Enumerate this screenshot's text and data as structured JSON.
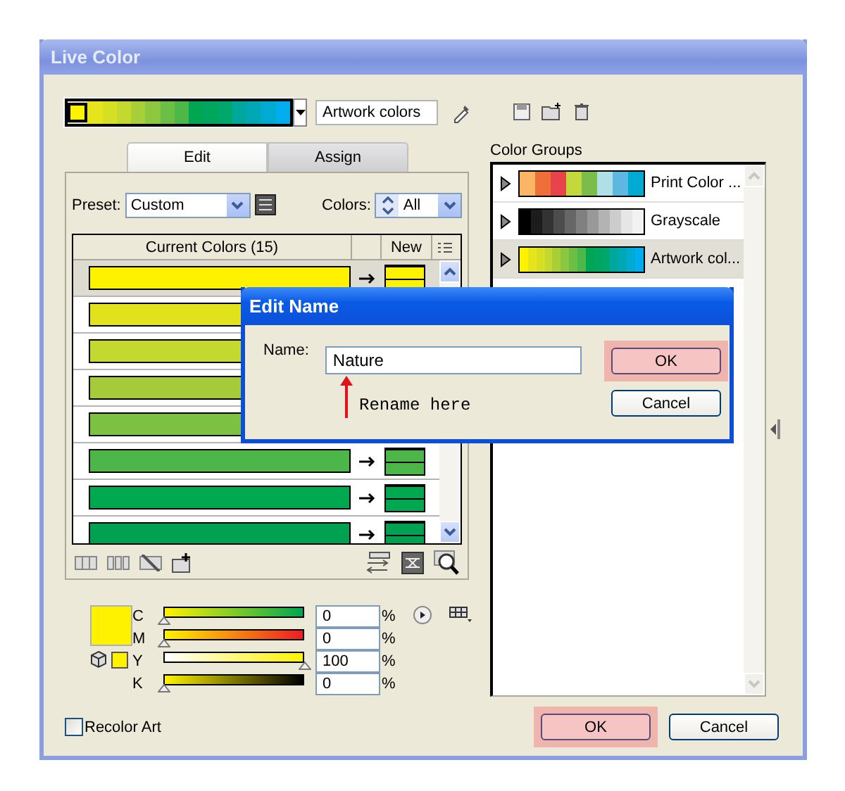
{
  "window": {
    "title": "Live Color"
  },
  "artwork_strip": {
    "name": "Artwork colors",
    "swatches": [
      {
        "color": "#fff200",
        "selected": true
      },
      {
        "color": "#e6e41a",
        "selected": false
      },
      {
        "color": "#d7df23",
        "selected": false
      },
      {
        "color": "#c4d92e",
        "selected": false
      },
      {
        "color": "#a8cf38",
        "selected": false
      },
      {
        "color": "#8dc63f",
        "selected": false
      },
      {
        "color": "#6cbe45",
        "selected": false
      },
      {
        "color": "#4db748",
        "selected": false
      },
      {
        "color": "#00a651",
        "selected": false
      },
      {
        "color": "#00a65d",
        "selected": false
      },
      {
        "color": "#00a76b",
        "selected": false
      },
      {
        "color": "#00a79d",
        "selected": false
      },
      {
        "color": "#00a8b5",
        "selected": false
      },
      {
        "color": "#00aad0",
        "selected": false
      },
      {
        "color": "#00aeef",
        "selected": false
      }
    ]
  },
  "tabs": [
    {
      "label": "Edit",
      "selected": true
    },
    {
      "label": "Assign",
      "selected": false
    }
  ],
  "preset": {
    "label": "Preset:",
    "value": "Custom"
  },
  "colors_filter": {
    "label": "Colors:",
    "value": "All"
  },
  "table": {
    "columns": [
      "Current Colors (15)",
      "New"
    ],
    "rows": [
      {
        "color": "#fff200",
        "selected": true,
        "new": {
          "color": "#fff200"
        }
      },
      {
        "color": "#e2e21c",
        "selected": false
      },
      {
        "color": "#c4d930",
        "selected": false
      },
      {
        "color": "#a5cb3a",
        "selected": false
      },
      {
        "color": "#7dc142",
        "selected": false
      },
      {
        "color": "#4cb748",
        "selected": false,
        "new": {
          "color": "#4cb748"
        }
      },
      {
        "color": "#00a84f",
        "selected": false,
        "new": {
          "color": "#00a84f"
        }
      },
      {
        "color": "#00a251",
        "selected": false,
        "new": {
          "color": "#00a251"
        }
      }
    ]
  },
  "color_editor": {
    "color": "#fff200",
    "channels": [
      {
        "name": "C",
        "level": 0,
        "value": "0",
        "unit": "%"
      },
      {
        "name": "M",
        "level": 0,
        "value": "0",
        "unit": "%"
      },
      {
        "name": "Y",
        "level": 1,
        "value": "100",
        "unit": "%"
      },
      {
        "name": "K",
        "level": 0,
        "value": "0",
        "unit": "%"
      }
    ]
  },
  "recolor_art": {
    "label": "Recolor Art",
    "checked": false
  },
  "color_groups": {
    "label": "Color Groups",
    "groups": [
      {
        "name": "Print Color ...",
        "selected": false,
        "swatches": [
          {
            "color": "#fbb665"
          },
          {
            "color": "#ef6f38"
          },
          {
            "color": "#e8434a"
          },
          {
            "color": "#c3d83a"
          },
          {
            "color": "#7cbc4b"
          },
          {
            "color": "#b0dfe5"
          },
          {
            "color": "#5cb8e0"
          },
          {
            "color": "#00aad3"
          }
        ]
      },
      {
        "name": "Grayscale",
        "selected": false,
        "swatches": [
          {
            "color": "#000000"
          },
          {
            "color": "#1c1c1c"
          },
          {
            "color": "#333333"
          },
          {
            "color": "#4d4d4d"
          },
          {
            "color": "#666666"
          },
          {
            "color": "#808080"
          },
          {
            "color": "#999999"
          },
          {
            "color": "#b3b3b3"
          },
          {
            "color": "#cccccc"
          },
          {
            "color": "#e6e6e6"
          },
          {
            "color": "#f2f2f2"
          }
        ]
      },
      {
        "name": "Artwork col...",
        "selected": true,
        "swatches": [
          {
            "color": "#fff200"
          },
          {
            "color": "#e6e41a"
          },
          {
            "color": "#d7df23"
          },
          {
            "color": "#c4d92e"
          },
          {
            "color": "#a8cf38"
          },
          {
            "color": "#8dc63f"
          },
          {
            "color": "#6cbe45"
          },
          {
            "color": "#4db748"
          },
          {
            "color": "#00a651"
          },
          {
            "color": "#00a65d"
          },
          {
            "color": "#00a76b"
          },
          {
            "color": "#00a79d"
          },
          {
            "color": "#00a8b5"
          },
          {
            "color": "#00aad0"
          },
          {
            "color": "#00aeef"
          }
        ]
      }
    ]
  },
  "buttons": [
    {
      "label": "OK",
      "highlighted": true
    },
    {
      "label": "Cancel",
      "highlighted": false
    }
  ],
  "edit_name_dialog": {
    "title": "Edit Name",
    "label": "Name:",
    "value": "Nature",
    "buttons": [
      {
        "label": "OK",
        "highlighted": true
      },
      {
        "label": "Cancel",
        "highlighted": false
      }
    ]
  },
  "annotation": {
    "text": "Rename here"
  }
}
